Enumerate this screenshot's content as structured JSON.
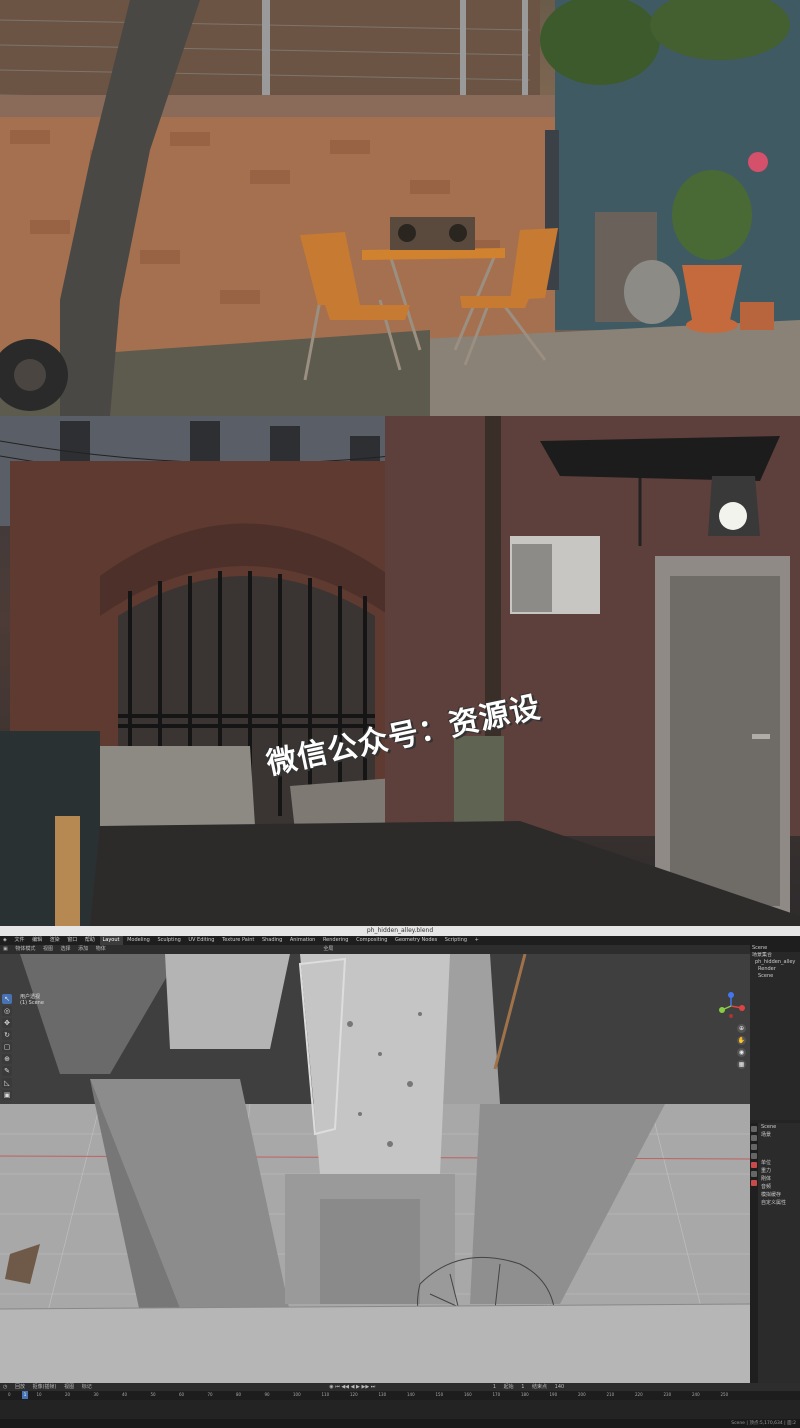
{
  "watermark": "微信公众号：资源设",
  "blender": {
    "window_title": "ph_hidden_alley.blend",
    "menus": [
      "文件",
      "编辑",
      "渲染",
      "窗口",
      "帮助"
    ],
    "workspace_tabs": [
      "Layout",
      "Modeling",
      "Sculpting",
      "UV Editing",
      "Texture Paint",
      "Shading",
      "Animation",
      "Rendering",
      "Compositing",
      "Geometry Nodes",
      "Scripting"
    ],
    "active_tab": "Layout",
    "header": {
      "mode": "物体模式",
      "menus": [
        "视图",
        "选择",
        "添加",
        "物体"
      ],
      "orientation": "全局"
    },
    "viewport_label": [
      "用户透视",
      "(1) Scene"
    ],
    "outliner": {
      "title": "Scene",
      "items": [
        "场景集合",
        "ph_hidden_alley",
        "Render",
        "Scene"
      ]
    },
    "properties": {
      "title": "Scene",
      "sections": [
        "场景",
        "单位",
        "重力",
        "刚体",
        "音频",
        "模拟缓存",
        "自定义属性"
      ]
    },
    "timeline": {
      "menus": [
        "回放",
        "抠像(插帧)",
        "视图",
        "标记"
      ],
      "current_frame": "1",
      "start_label": "起始",
      "start_value": "1",
      "end_label": "结束点",
      "end_value": "140",
      "ticks": [
        "0",
        "10",
        "20",
        "30",
        "40",
        "50",
        "60",
        "70",
        "80",
        "90",
        "100",
        "110",
        "120",
        "130",
        "140",
        "150",
        "160",
        "170",
        "180",
        "190",
        "200",
        "210",
        "220",
        "230",
        "240",
        "250"
      ]
    },
    "status_bar": "Scene | 顶点:5,170,634 | 面:2"
  }
}
